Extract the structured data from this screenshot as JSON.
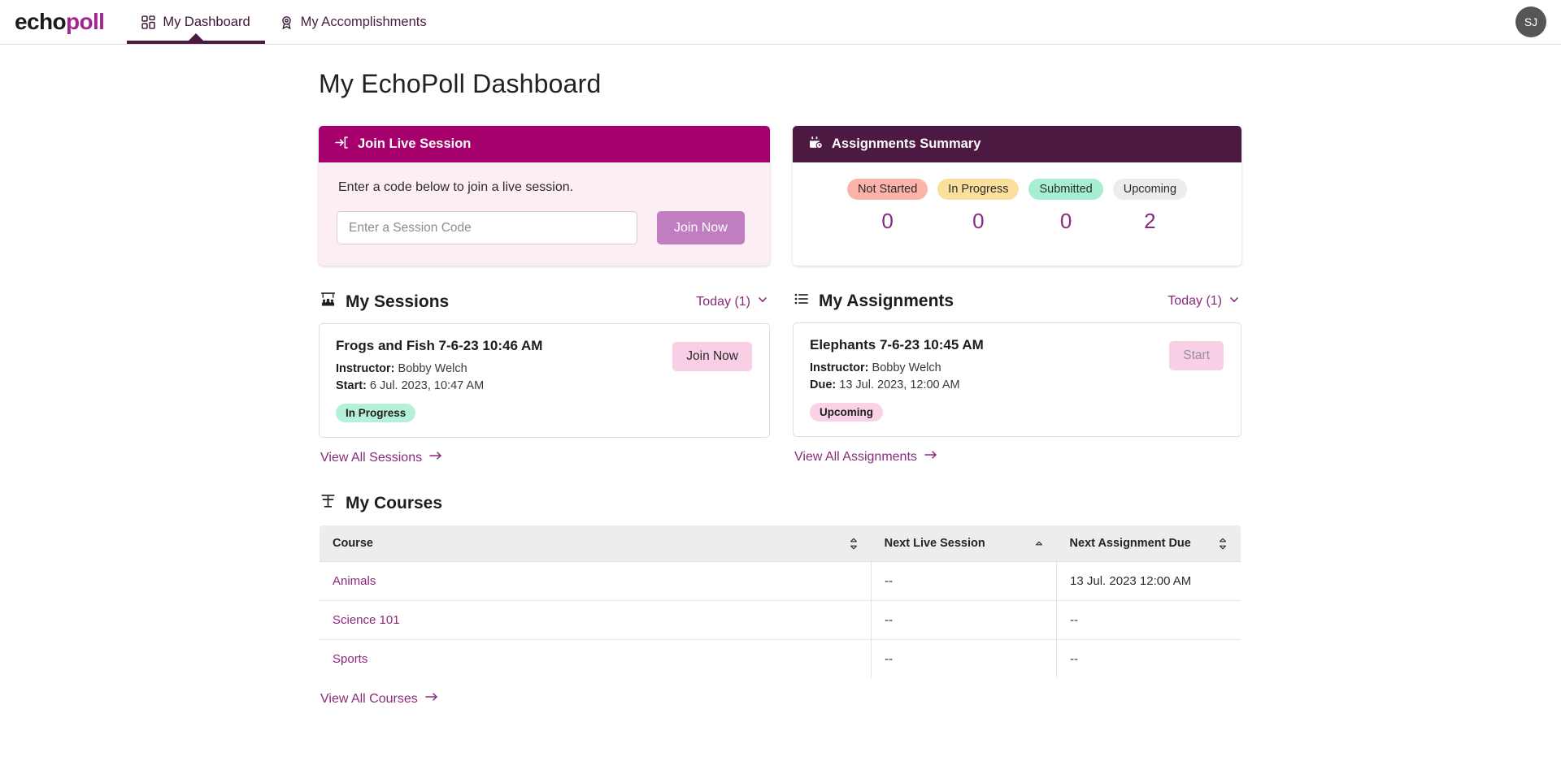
{
  "brand": {
    "part1": "echo",
    "part2": "poll"
  },
  "nav": {
    "tabs": [
      {
        "label": "My Dashboard",
        "icon": "grid-icon",
        "active": true
      },
      {
        "label": "My Accomplishments",
        "icon": "award-icon",
        "active": false
      }
    ],
    "avatar_initials": "SJ"
  },
  "page": {
    "title": "My EchoPoll Dashboard"
  },
  "join_live_session": {
    "header": "Join Live Session",
    "header_icon": "login-arrow-icon",
    "description": "Enter a code below to join a live session.",
    "input_placeholder": "Enter a Session Code",
    "input_value": "",
    "button_label": "Join Now"
  },
  "assignments_summary": {
    "header": "Assignments Summary",
    "header_icon": "calendar-clock-icon",
    "stats": [
      {
        "label": "Not Started",
        "value": "0",
        "color": "#fcb4aa"
      },
      {
        "label": "In Progress",
        "value": "0",
        "color": "#fbdf9c"
      },
      {
        "label": "Submitted",
        "value": "0",
        "color": "#a8eed2"
      },
      {
        "label": "Upcoming",
        "value": "2",
        "color": "#ececec"
      }
    ]
  },
  "my_sessions": {
    "title": "My Sessions",
    "title_icon": "presentation-audience-icon",
    "filter_label": "Today (1)",
    "items": [
      {
        "title": "Frogs and Fish 7-6-23 10:46 AM",
        "instructor_label": "Instructor:",
        "instructor": "Bobby Welch",
        "time_label": "Start:",
        "time": "6 Jul. 2023, 10:47 AM",
        "status": "In Progress",
        "button_label": "Join Now"
      }
    ],
    "view_all_label": "View All Sessions"
  },
  "my_assignments": {
    "title": "My Assignments",
    "title_icon": "list-icon",
    "filter_label": "Today (1)",
    "items": [
      {
        "title": "Elephants 7-6-23 10:45 AM",
        "instructor_label": "Instructor:",
        "instructor": "Bobby Welch",
        "time_label": "Due:",
        "time": "13 Jul. 2023, 12:00 AM",
        "status": "Upcoming",
        "button_label": "Start"
      }
    ],
    "view_all_label": "View All Assignments"
  },
  "my_courses": {
    "title": "My Courses",
    "title_icon": "lectern-icon",
    "columns": [
      {
        "label": "Course",
        "sort": "none"
      },
      {
        "label": "Next Live Session",
        "sort": "asc"
      },
      {
        "label": "Next Assignment Due",
        "sort": "none"
      }
    ],
    "rows": [
      {
        "course": "Animals",
        "next_live_session": "--",
        "next_assignment_due": "13 Jul. 2023 12:00 AM"
      },
      {
        "course": "Science 101",
        "next_live_session": "--",
        "next_assignment_due": "--"
      },
      {
        "course": "Sports",
        "next_live_session": "--",
        "next_assignment_due": "--"
      }
    ],
    "view_all_label": "View All Courses"
  },
  "colors": {
    "brand_magenta": "#a5248c",
    "header_magenta": "#a5006b",
    "header_plum": "#4b1942",
    "link_purple": "#8a2a7a",
    "join_button": "#c07ec0"
  }
}
